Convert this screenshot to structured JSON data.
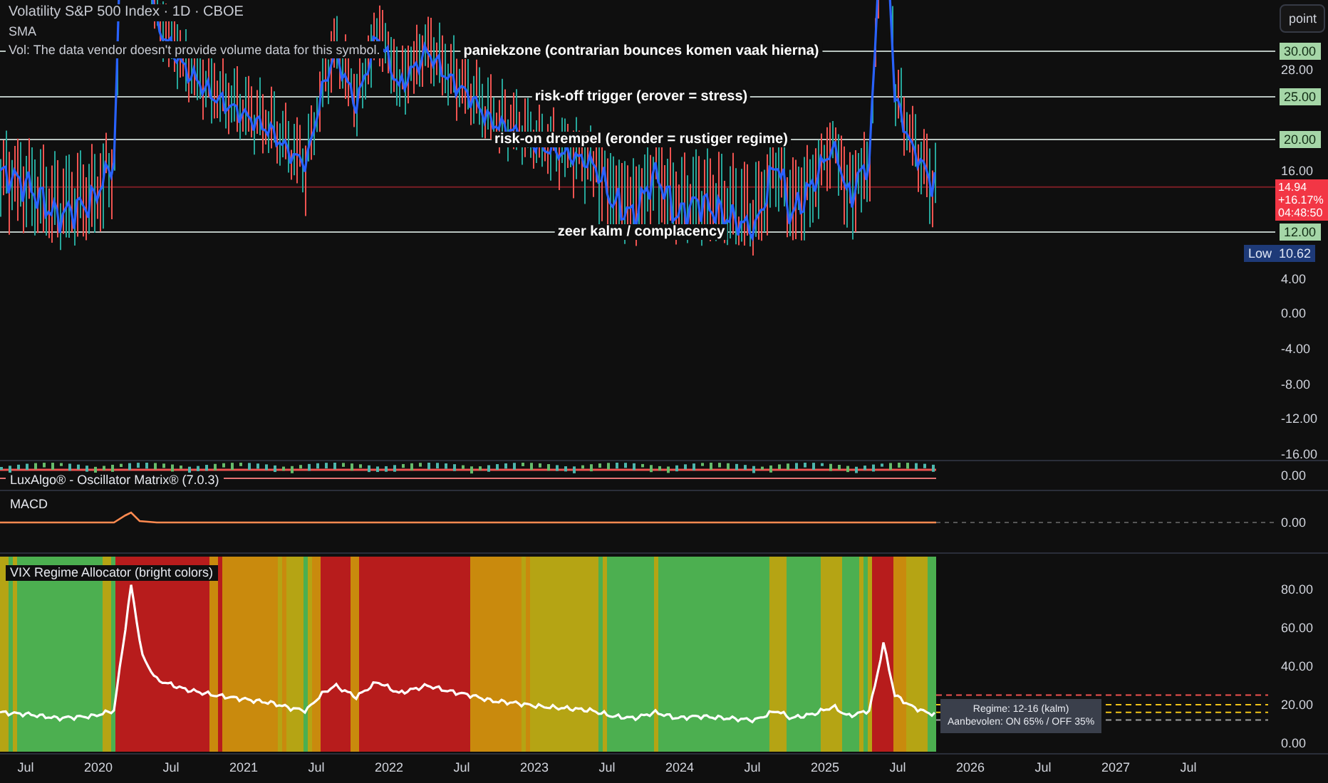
{
  "legend": {
    "title": "Volatility S&P 500 Index · 1D · CBOE",
    "items": [
      "SMA",
      "Vol: The data vendor doesn't provide volume data for this symbol."
    ]
  },
  "scale_button": "point",
  "levels": [
    {
      "label": "paniekzone (contrarian bounces komen vaak hierna)",
      "tag": "30.00"
    },
    {
      "label": "risk-off trigger (erover = stress)",
      "tag": "25.00"
    },
    {
      "label": "risk-on drempel (eronder = rustiger regime)",
      "tag": "20.00"
    },
    {
      "label": "zeer kalm / complacency",
      "tag": "12.00"
    }
  ],
  "price_axis": [
    "28.00",
    "16.00",
    "4.00",
    "0.00",
    "-4.00",
    "-8.00",
    "-12.00",
    "-16.00"
  ],
  "last_price": {
    "price": "14.94",
    "change": "+16.17%",
    "countdown": "04:48:50"
  },
  "low": {
    "label": "Low",
    "value": "10.62"
  },
  "panes": [
    {
      "kind": "oscillator",
      "title": "LuxAlgo® - Oscillator Matrix® (7.0.3)",
      "axis": [
        "0.00"
      ]
    },
    {
      "kind": "macd",
      "title": "MACD",
      "axis": [
        "0.00"
      ]
    },
    {
      "kind": "regime",
      "title": "VIX Regime Allocator (bright colors)",
      "axis": [
        "80.00",
        "60.00",
        "40.00",
        "20.00",
        "0.00"
      ]
    }
  ],
  "tooltip": {
    "lines": [
      "Regime: 12-16 (kalm)",
      "Aanbevolen: ON 65% / OFF 35%"
    ]
  },
  "time_axis": [
    "Jul",
    "2020",
    "Jul",
    "2021",
    "Jul",
    "2022",
    "Jul",
    "2023",
    "Jul",
    "2024",
    "Jul",
    "2025",
    "Jul",
    "2026",
    "Jul",
    "2027",
    "Jul"
  ]
}
